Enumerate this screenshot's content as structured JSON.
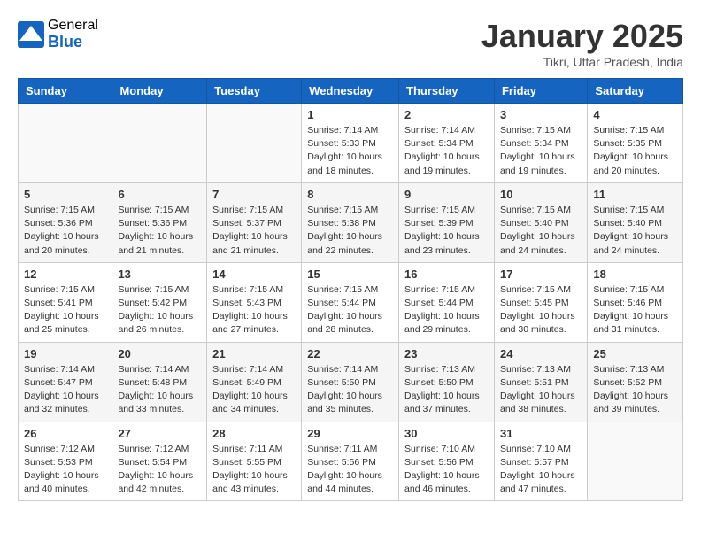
{
  "logo": {
    "general": "General",
    "blue": "Blue"
  },
  "title": "January 2025",
  "location": "Tikri, Uttar Pradesh, India",
  "days_of_week": [
    "Sunday",
    "Monday",
    "Tuesday",
    "Wednesday",
    "Thursday",
    "Friday",
    "Saturday"
  ],
  "weeks": [
    [
      {
        "day": "",
        "info": ""
      },
      {
        "day": "",
        "info": ""
      },
      {
        "day": "",
        "info": ""
      },
      {
        "day": "1",
        "info": "Sunrise: 7:14 AM\nSunset: 5:33 PM\nDaylight: 10 hours and 18 minutes."
      },
      {
        "day": "2",
        "info": "Sunrise: 7:14 AM\nSunset: 5:34 PM\nDaylight: 10 hours and 19 minutes."
      },
      {
        "day": "3",
        "info": "Sunrise: 7:15 AM\nSunset: 5:34 PM\nDaylight: 10 hours and 19 minutes."
      },
      {
        "day": "4",
        "info": "Sunrise: 7:15 AM\nSunset: 5:35 PM\nDaylight: 10 hours and 20 minutes."
      }
    ],
    [
      {
        "day": "5",
        "info": "Sunrise: 7:15 AM\nSunset: 5:36 PM\nDaylight: 10 hours and 20 minutes."
      },
      {
        "day": "6",
        "info": "Sunrise: 7:15 AM\nSunset: 5:36 PM\nDaylight: 10 hours and 21 minutes."
      },
      {
        "day": "7",
        "info": "Sunrise: 7:15 AM\nSunset: 5:37 PM\nDaylight: 10 hours and 21 minutes."
      },
      {
        "day": "8",
        "info": "Sunrise: 7:15 AM\nSunset: 5:38 PM\nDaylight: 10 hours and 22 minutes."
      },
      {
        "day": "9",
        "info": "Sunrise: 7:15 AM\nSunset: 5:39 PM\nDaylight: 10 hours and 23 minutes."
      },
      {
        "day": "10",
        "info": "Sunrise: 7:15 AM\nSunset: 5:40 PM\nDaylight: 10 hours and 24 minutes."
      },
      {
        "day": "11",
        "info": "Sunrise: 7:15 AM\nSunset: 5:40 PM\nDaylight: 10 hours and 24 minutes."
      }
    ],
    [
      {
        "day": "12",
        "info": "Sunrise: 7:15 AM\nSunset: 5:41 PM\nDaylight: 10 hours and 25 minutes."
      },
      {
        "day": "13",
        "info": "Sunrise: 7:15 AM\nSunset: 5:42 PM\nDaylight: 10 hours and 26 minutes."
      },
      {
        "day": "14",
        "info": "Sunrise: 7:15 AM\nSunset: 5:43 PM\nDaylight: 10 hours and 27 minutes."
      },
      {
        "day": "15",
        "info": "Sunrise: 7:15 AM\nSunset: 5:44 PM\nDaylight: 10 hours and 28 minutes."
      },
      {
        "day": "16",
        "info": "Sunrise: 7:15 AM\nSunset: 5:44 PM\nDaylight: 10 hours and 29 minutes."
      },
      {
        "day": "17",
        "info": "Sunrise: 7:15 AM\nSunset: 5:45 PM\nDaylight: 10 hours and 30 minutes."
      },
      {
        "day": "18",
        "info": "Sunrise: 7:15 AM\nSunset: 5:46 PM\nDaylight: 10 hours and 31 minutes."
      }
    ],
    [
      {
        "day": "19",
        "info": "Sunrise: 7:14 AM\nSunset: 5:47 PM\nDaylight: 10 hours and 32 minutes."
      },
      {
        "day": "20",
        "info": "Sunrise: 7:14 AM\nSunset: 5:48 PM\nDaylight: 10 hours and 33 minutes."
      },
      {
        "day": "21",
        "info": "Sunrise: 7:14 AM\nSunset: 5:49 PM\nDaylight: 10 hours and 34 minutes."
      },
      {
        "day": "22",
        "info": "Sunrise: 7:14 AM\nSunset: 5:50 PM\nDaylight: 10 hours and 35 minutes."
      },
      {
        "day": "23",
        "info": "Sunrise: 7:13 AM\nSunset: 5:50 PM\nDaylight: 10 hours and 37 minutes."
      },
      {
        "day": "24",
        "info": "Sunrise: 7:13 AM\nSunset: 5:51 PM\nDaylight: 10 hours and 38 minutes."
      },
      {
        "day": "25",
        "info": "Sunrise: 7:13 AM\nSunset: 5:52 PM\nDaylight: 10 hours and 39 minutes."
      }
    ],
    [
      {
        "day": "26",
        "info": "Sunrise: 7:12 AM\nSunset: 5:53 PM\nDaylight: 10 hours and 40 minutes."
      },
      {
        "day": "27",
        "info": "Sunrise: 7:12 AM\nSunset: 5:54 PM\nDaylight: 10 hours and 42 minutes."
      },
      {
        "day": "28",
        "info": "Sunrise: 7:11 AM\nSunset: 5:55 PM\nDaylight: 10 hours and 43 minutes."
      },
      {
        "day": "29",
        "info": "Sunrise: 7:11 AM\nSunset: 5:56 PM\nDaylight: 10 hours and 44 minutes."
      },
      {
        "day": "30",
        "info": "Sunrise: 7:10 AM\nSunset: 5:56 PM\nDaylight: 10 hours and 46 minutes."
      },
      {
        "day": "31",
        "info": "Sunrise: 7:10 AM\nSunset: 5:57 PM\nDaylight: 10 hours and 47 minutes."
      },
      {
        "day": "",
        "info": ""
      }
    ]
  ]
}
